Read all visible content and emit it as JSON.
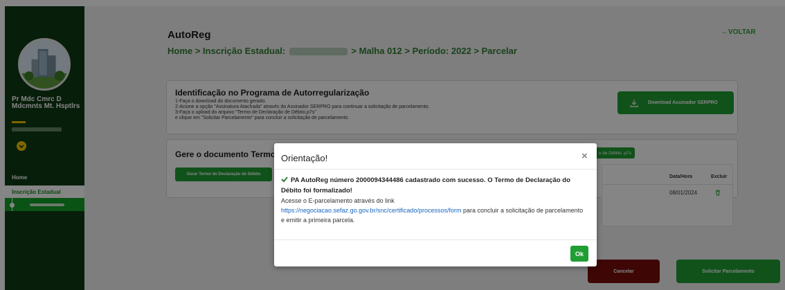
{
  "sidebar": {
    "user_name": "Pr Mdc Cmrc D Mdcmnts Mt. Hsptlrs",
    "nav_home": "Home",
    "nav_inscricao": "Inscrição Estadual"
  },
  "header": {
    "app_title": "AutoReg",
    "breadcrumb_prefix": "Home > Inscrição Estadual:",
    "breadcrumb_suffix": "> Malha 012 > Período: 2022 > Parcelar",
    "back_label": "←VOLTAR"
  },
  "identificacao": {
    "title": "Identificação no Programa de Autorregularização",
    "step1": "1-Faça o download do documento gerado.",
    "step2": "2-Acione a opção \"Assinatura Atachada\" através do Assinador SERPRO para continuar a solicitação de parcelamento.",
    "step3": "3-Faça o upload do arquivo \"Termo de Declaração de Débito.p7s\"",
    "step4": "e clique em \"Solicitar Parcelamento\" para concluir a solicitação de parcelamento.",
    "download_label": "Download Assinador SERPRO"
  },
  "documento": {
    "title": "Gere o documento Termo d",
    "gen_label": "Gerar Termo de Declaração de Débito",
    "upload_label": "o de Débito .p7s",
    "col_datahora": "Data/Hora",
    "col_excluir": "Excluir",
    "row_date": "08/01/2024"
  },
  "actions": {
    "cancel_label": "Cancelar",
    "submit_label": "Solicitar Parcelamento"
  },
  "modal": {
    "title": "Orientação!",
    "close": "×",
    "lead": "PA AutoReg número 2000094344486 cadastrado com sucesso. O Termo de Declaração do Débito foi formalizado!",
    "line2": "Acesse o E-parcelamento através do link",
    "link": "https://negociacao.sefaz.go.gov.br/snc/certificado/processos/form",
    "line3": "para concluir a solicitação de parcelamento e emitir a primeira parcela.",
    "ok_label": "Ok"
  },
  "colors": {
    "primary_green": "#1f9e33",
    "sidebar_dark": "#0f3b14",
    "danger": "#7a0d0d",
    "accent_yellow": "#f4c300"
  }
}
